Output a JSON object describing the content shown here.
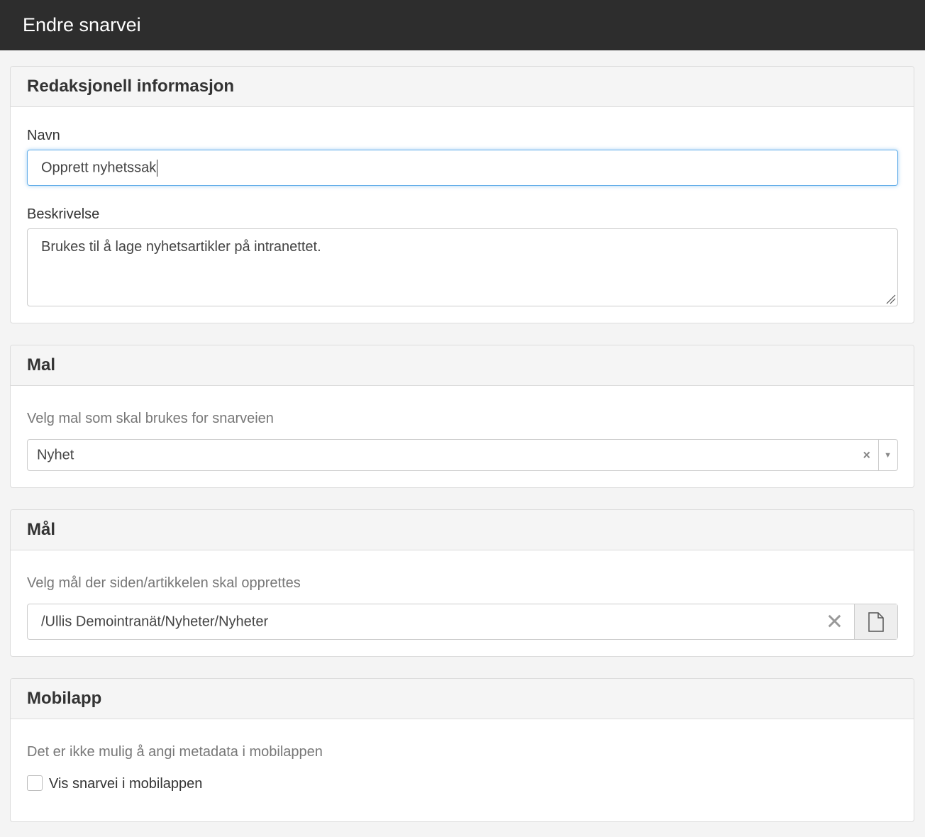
{
  "header": {
    "title": "Endre snarvei"
  },
  "editorial": {
    "title": "Redaksjonell informasjon",
    "name_label": "Navn",
    "name_value": "Opprett nyhetssak",
    "description_label": "Beskrivelse",
    "description_value": "Brukes til å lage nyhetsartikler på intranettet."
  },
  "template": {
    "title": "Mal",
    "help": "Velg mal som skal brukes for snarveien",
    "selected": "Nyhet",
    "clear_glyph": "×",
    "arrow_glyph": "▼"
  },
  "target": {
    "title": "Mål",
    "help": "Velg mål der siden/artikkelen skal opprettes",
    "value": "/Ullis Demointranät/Nyheter/Nyheter",
    "clear_glyph": "✕",
    "browse_icon": "file-icon"
  },
  "mobile": {
    "title": "Mobilapp",
    "help": "Det er ikke mulig å angi metadata i mobilappen",
    "checkbox_label": "Vis snarvei i mobilappen",
    "checked": false
  },
  "colors": {
    "topbar": "#2d2d2d",
    "focus_border": "#66afe9",
    "panel_header": "#f5f5f5"
  }
}
